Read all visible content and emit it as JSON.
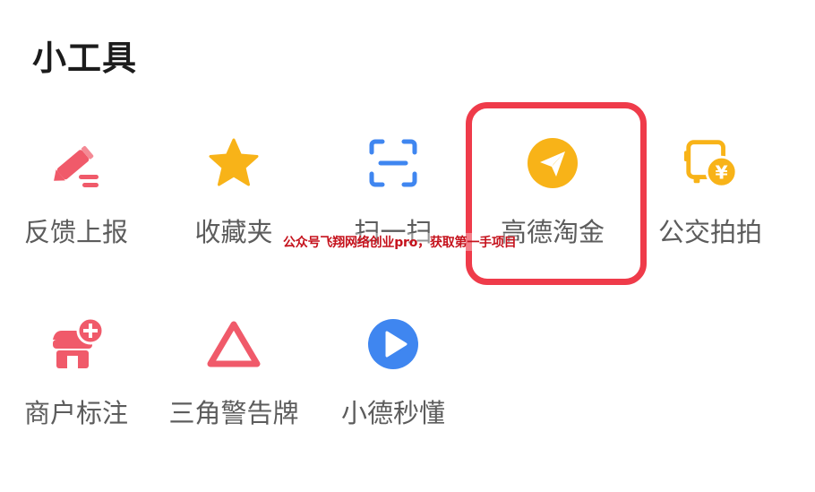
{
  "section": {
    "title": "小工具"
  },
  "tools": [
    {
      "label": "反馈上报",
      "icon": "edit-report-icon",
      "color": "#f05a6a"
    },
    {
      "label": "收藏夹",
      "icon": "star-icon",
      "color": "#f8b318"
    },
    {
      "label": "扫一扫",
      "icon": "scan-icon",
      "color": "#3f86f0"
    },
    {
      "label": "高德淘金",
      "icon": "paper-plane-coin-icon",
      "color": "#f8b318"
    },
    {
      "label": "公交拍拍",
      "icon": "bus-yuan-icon",
      "color": "#f8b318"
    },
    {
      "label": "商户标注",
      "icon": "shop-add-icon",
      "color": "#f05a6a"
    },
    {
      "label": "三角警告牌",
      "icon": "warning-triangle-icon",
      "color": "#f05a6a"
    },
    {
      "label": "小德秒懂",
      "icon": "play-circle-icon",
      "color": "#3f86f0"
    }
  ],
  "watermark": {
    "text": "公众号飞翔网络创业pro，获取第一手项目"
  },
  "highlight": {
    "target": "高德淘金",
    "color": "#ef3b4a"
  }
}
